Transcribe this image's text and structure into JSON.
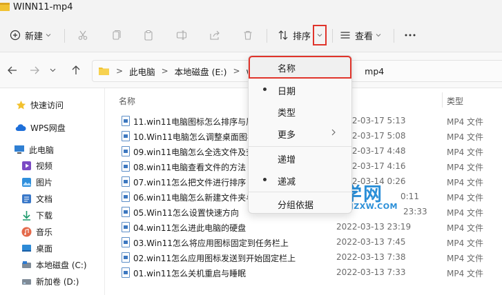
{
  "window": {
    "title": "WINN11-mp4"
  },
  "toolbar": {
    "new_label": "新建",
    "sort_label": "排序",
    "view_label": "查看"
  },
  "address": {
    "crumbs": [
      "此电脑",
      "本地磁盘 (E:)",
      "win",
      "mp4"
    ]
  },
  "sidebar": {
    "items": [
      {
        "label": "快速访问",
        "icon": "star-icon"
      },
      {
        "label": "WPS网盘",
        "icon": "cloud-icon"
      },
      {
        "label": "此电脑",
        "icon": "computer-icon"
      },
      {
        "label": "视频",
        "icon": "video-icon"
      },
      {
        "label": "图片",
        "icon": "picture-icon"
      },
      {
        "label": "文档",
        "icon": "document-icon"
      },
      {
        "label": "下载",
        "icon": "download-icon"
      },
      {
        "label": "音乐",
        "icon": "music-icon"
      },
      {
        "label": "桌面",
        "icon": "desktop-icon"
      },
      {
        "label": "本地磁盘 (C:)",
        "icon": "drive-icon"
      },
      {
        "label": "新加卷 (D:)",
        "icon": "drive-icon"
      }
    ]
  },
  "columns": {
    "name": "名称",
    "type": "类型"
  },
  "files": [
    {
      "name": "11.win11电脑图标怎么排序与属",
      "date": "2022-03-17 5:13",
      "type": "MP4 文件"
    },
    {
      "name": "10.Win11电脑怎么调整桌面图标",
      "date": "2022-03-17 5:08",
      "type": "MP4 文件"
    },
    {
      "name": "09.win11电脑怎么全选文件及查",
      "date": "2022-03-17 4:48",
      "type": "MP4 文件"
    },
    {
      "name": "08.win11电脑查看文件的方法",
      "date": "2022-03-17 4:16",
      "type": "MP4 文件"
    },
    {
      "name": "07.win11怎么把文件进行排序",
      "date": "2022-03-14 0:26",
      "type": "MP4 文件"
    },
    {
      "name": "06.win11电脑怎么新建文件夹与",
      "date": "0:11",
      "type": "MP4 文件"
    },
    {
      "name": "05.Win11怎么设置快速方向",
      "date": "23:33",
      "type": "MP4 文件"
    },
    {
      "name": "04.win11怎么进此电脑的硬盘",
      "date": "2022-03-13 23:19",
      "type": "MP4 文件"
    },
    {
      "name": "03.Win11怎么将应用图标固定到任务栏上",
      "date": "2022-03-13 7:45",
      "type": "MP4 文件"
    },
    {
      "name": "02.win11怎么应用图标发送到开始固定栏上",
      "date": "2022-03-13 7:38",
      "type": "MP4 文件"
    },
    {
      "name": "01.win11怎么关机重启与睡眠",
      "date": "2022-03-13 7:33",
      "type": "MP4 文件"
    }
  ],
  "sort_menu": {
    "items": [
      {
        "label": "名称",
        "selected": false
      },
      {
        "label": "日期",
        "selected": true
      },
      {
        "label": "类型",
        "selected": false
      },
      {
        "label": "更多",
        "selected": false
      },
      {
        "label": "递增",
        "selected": false
      },
      {
        "label": "递减",
        "selected": true
      },
      {
        "label": "分组依据",
        "selected": false
      }
    ]
  },
  "watermark": {
    "main": "软件自学网",
    "url": "WWW.RJZXW.COM"
  },
  "colors": {
    "highlight": "#e0332a",
    "watermark": "#2a8fd8",
    "folder": "#f1c232"
  }
}
